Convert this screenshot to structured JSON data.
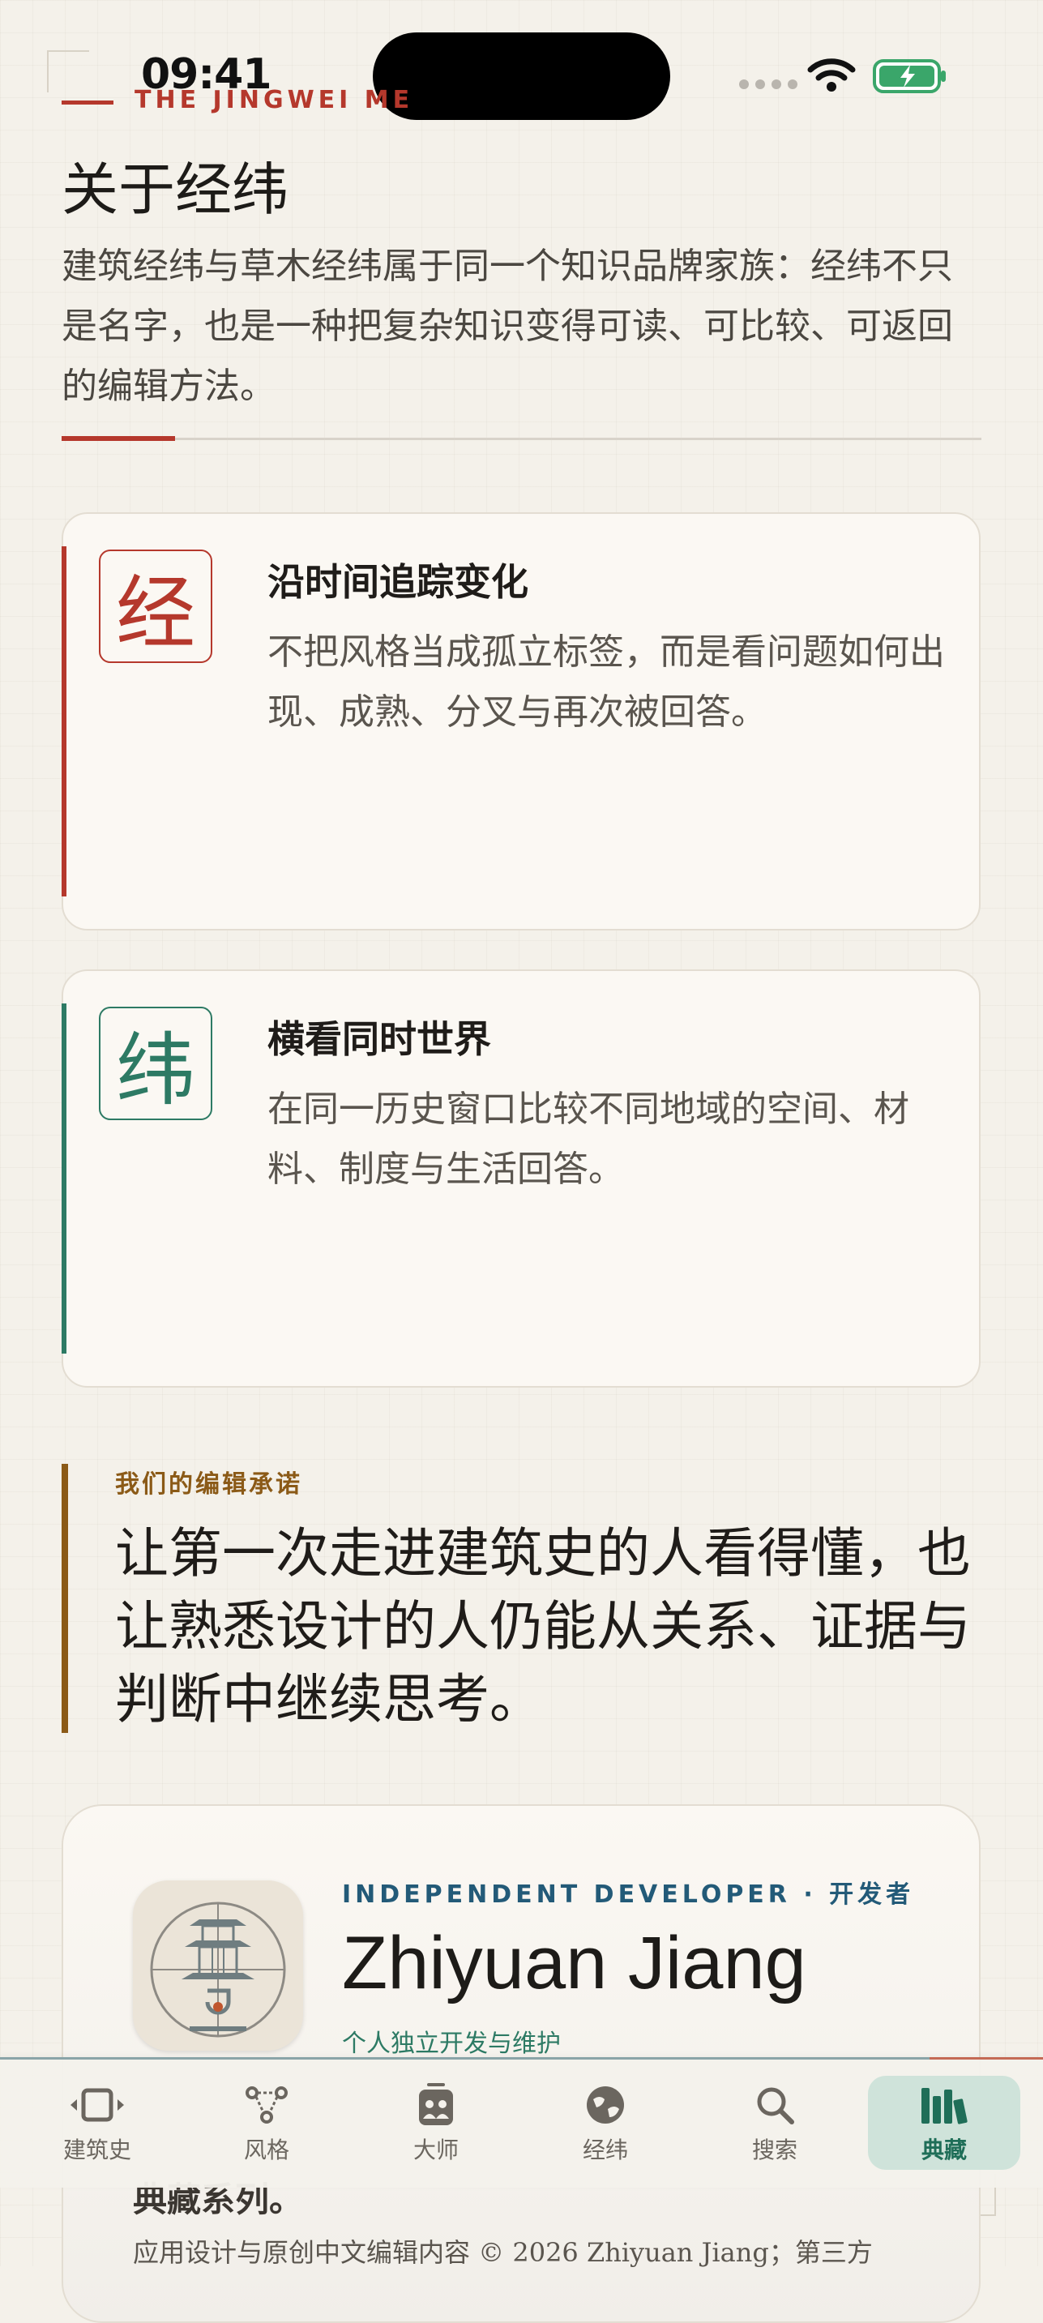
{
  "status": {
    "time": "09:41"
  },
  "header": {
    "eyebrow": "THE JINGWEI ME",
    "title": "关于经纬",
    "intro": "建筑经纬与草木经纬属于同一个知识品牌家族：经纬不只是名字，也是一种把复杂知识变得可读、可比较、可返回的编辑方法。"
  },
  "cards": [
    {
      "glyph": "经",
      "title": "沿时间追踪变化",
      "body": "不把风格当成孤立标签，而是看问题如何出现、成熟、分叉与再次被回答。",
      "accent": "#b5382c"
    },
    {
      "glyph": "纬",
      "title": "横看同时世界",
      "body": "在同一历史窗口比较不同地域的空间、材料、制度与生活回答。",
      "accent": "#2d7a64"
    }
  ],
  "pledge": {
    "label": "我们的编辑承诺",
    "text": "让第一次走进建筑史的人看得懂，也让熟悉设计的人仍能从关系、证据与判断中继续思考。"
  },
  "developer": {
    "kicker": "INDEPENDENT DEVELOPER · 开发者",
    "name": "Zhiyuan Jiang",
    "subtitle": "个人独立开发与维护"
  },
  "peek": {
    "heading": "典藏系列。",
    "copyright": "应用设计与原创中文编辑内容 © 2026 Zhiyuan Jiang；第三方"
  },
  "tabs": [
    {
      "label": "建筑史",
      "icon": "film-strip-icon"
    },
    {
      "label": "风格",
      "icon": "network-nodes-icon"
    },
    {
      "label": "大师",
      "icon": "people-card-icon"
    },
    {
      "label": "经纬",
      "icon": "globe-icon"
    },
    {
      "label": "搜索",
      "icon": "search-icon"
    },
    {
      "label": "典藏",
      "icon": "books-icon",
      "active": true
    }
  ],
  "colors": {
    "accent_red": "#b5382c",
    "accent_green": "#2d7a64",
    "accent_gold": "#8b5a17",
    "accent_blue": "#235a78"
  }
}
